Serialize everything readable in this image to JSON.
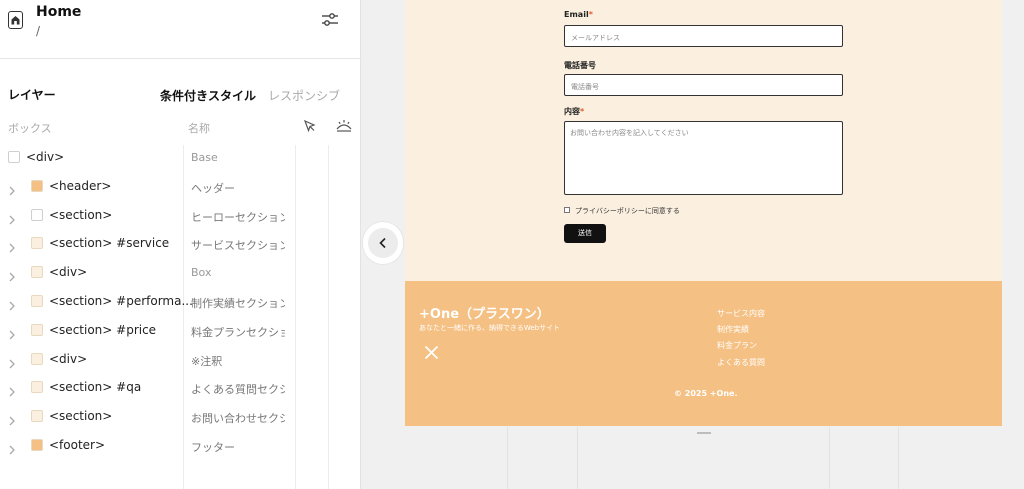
{
  "header": {
    "page_name": "Home",
    "page_path": "/"
  },
  "tabs": {
    "layers": "レイヤー",
    "conditional": "条件付きスタイル",
    "responsive": "レスポンシブ"
  },
  "columns": {
    "box": "ボックス",
    "name": "名称"
  },
  "layers": [
    {
      "tag": "<div>",
      "name": "Base",
      "swatch": "#ffffff",
      "expandable": false
    },
    {
      "tag": "<header>",
      "name": "ヘッダー",
      "swatch": "#f5c083",
      "expandable": true
    },
    {
      "tag": "<section>",
      "name": "ヒーローセクション",
      "swatch": "#ffffff",
      "expandable": true
    },
    {
      "tag": "<section> #service",
      "name": "サービスセクション",
      "swatch": "#fbf0e0",
      "expandable": true
    },
    {
      "tag": "<div>",
      "name": "Box",
      "swatch": "#fbf0e0",
      "expandable": true
    },
    {
      "tag": "<section> #performa...",
      "name": "制作実績セクション",
      "swatch": "#fbf0e0",
      "expandable": true
    },
    {
      "tag": "<section> #price",
      "name": "料金プランセクショ",
      "swatch": "#fbf0e0",
      "expandable": true
    },
    {
      "tag": "<div>",
      "name": "※注釈",
      "swatch": "#fbf0e0",
      "expandable": true
    },
    {
      "tag": "<section> #qa",
      "name": "よくある質問セクシ",
      "swatch": "#fbf0e0",
      "expandable": true
    },
    {
      "tag": "<section>",
      "name": "お問い合わせセクシ",
      "swatch": "#fbf0e0",
      "expandable": true
    },
    {
      "tag": "<footer>",
      "name": "フッター",
      "swatch": "#f5c083",
      "expandable": true
    }
  ],
  "form": {
    "email_label": "Email",
    "email_placeholder": "メールアドレス",
    "phone_label": "電話番号",
    "phone_placeholder": "電話番号",
    "content_label": "内容",
    "content_placeholder": "お問い合わせ内容を記入してください",
    "required_mark": "*",
    "privacy_label": "プライバシーポリシーに同意する",
    "submit_label": "送信"
  },
  "footer": {
    "brand": "+One（プラスワン）",
    "tagline": "あなたと一緒に作る、納得できるWebサイト",
    "links": [
      "サービス内容",
      "制作実績",
      "料金プラン",
      "よくある質問"
    ],
    "copyright": "© 2025 +One."
  },
  "icons": {
    "home": "home-icon",
    "filter": "sliders-icon",
    "pointer": "pointer-icon",
    "visibility": "eye-off-icon",
    "collapse": "chevron-left-icon",
    "social": "x-logo-icon"
  },
  "colors": {
    "cream": "#fbf0e0",
    "orange": "#f5c083",
    "accent": "#111111"
  }
}
